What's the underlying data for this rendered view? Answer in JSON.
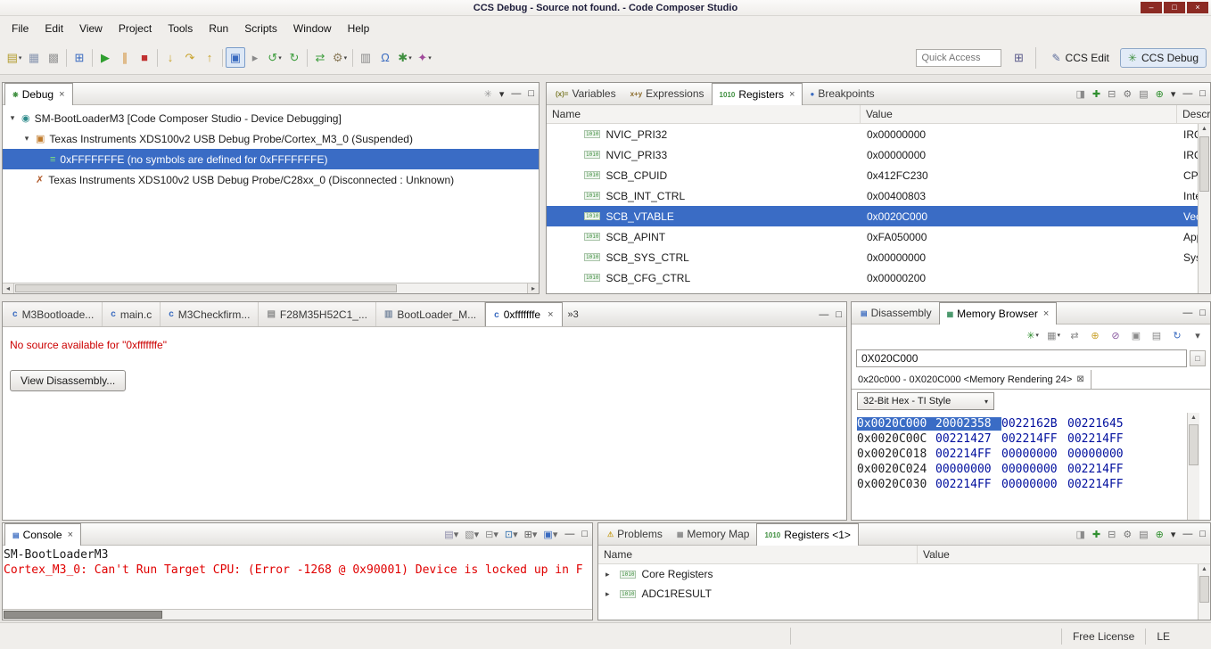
{
  "ui": {
    "dropdown_arrow": "▾",
    "close_glyph": "×",
    "close_box": "⊠",
    "menu_glyph": "▾",
    "min_glyph": "—",
    "max_glyph": "□",
    "expand_collapsed": "▸",
    "bin_icon": "1010",
    "scroll_left": "◂",
    "scroll_right": "▸",
    "scroll_up": "▲",
    "scroll_down": "▼"
  },
  "colors": {
    "selection": "#3a6cc5",
    "error_text": "#e00000",
    "memory_value": "#000f9e",
    "titlebar_button": "#8c2b24"
  },
  "titlebar": {
    "title": "CCS Debug - Source not found. - Code Composer Studio",
    "buttons": [
      {
        "name": "minimize-button",
        "glyph": "–"
      },
      {
        "name": "maximize-button",
        "glyph": "□"
      },
      {
        "name": "close-button",
        "glyph": "×"
      }
    ]
  },
  "menubar": {
    "items": [
      {
        "name": "menu-file",
        "label": "File"
      },
      {
        "name": "menu-edit",
        "label": "Edit"
      },
      {
        "name": "menu-view",
        "label": "View"
      },
      {
        "name": "menu-project",
        "label": "Project"
      },
      {
        "name": "menu-tools",
        "label": "Tools"
      },
      {
        "name": "menu-run",
        "label": "Run"
      },
      {
        "name": "menu-scripts",
        "label": "Scripts"
      },
      {
        "name": "menu-window",
        "label": "Window"
      },
      {
        "name": "menu-help",
        "label": "Help"
      }
    ]
  },
  "toolbar": {
    "icons": [
      {
        "name": "new-file-button",
        "glyph": "▤",
        "color": "#b09a2a",
        "dd": true
      },
      {
        "name": "save-button",
        "glyph": "▦",
        "color": "#8a97b0"
      },
      {
        "name": "save-all-button",
        "glyph": "▩",
        "color": "#9a9a9a"
      },
      {
        "name": "separator",
        "sep": true,
        "glyph": ""
      },
      {
        "name": "target-console-button",
        "glyph": "⊞",
        "color": "#3a6bc0"
      },
      {
        "name": "separator",
        "sep": true,
        "glyph": ""
      },
      {
        "name": "resume-button",
        "glyph": "▶",
        "color": "#2f9e2f"
      },
      {
        "name": "suspend-button",
        "glyph": "∥",
        "color": "#d08a2a"
      },
      {
        "name": "terminate-button",
        "glyph": "■",
        "color": "#c03030"
      },
      {
        "name": "separator",
        "sep": true,
        "glyph": ""
      },
      {
        "name": "step-into-button",
        "glyph": "↓",
        "color": "#c8a22a"
      },
      {
        "name": "step-over-button",
        "glyph": "↷",
        "color": "#c8a22a"
      },
      {
        "name": "step-return-button",
        "glyph": "↑",
        "color": "#c8a22a"
      },
      {
        "name": "separator",
        "sep": true,
        "glyph": ""
      },
      {
        "name": "instruction-stepping-toggle",
        "glyph": "▣",
        "color": "#3a6bc0",
        "pressed": true
      },
      {
        "name": "assembly-step-button",
        "glyph": "▸",
        "color": "#8a8a8a"
      },
      {
        "name": "reset-button",
        "glyph": "↺",
        "color": "#3f9e3f",
        "dd": true
      },
      {
        "name": "restart-button",
        "glyph": "↻",
        "color": "#3f9e3f"
      },
      {
        "name": "separator",
        "sep": true,
        "glyph": ""
      },
      {
        "name": "refresh-button",
        "glyph": "⇄",
        "color": "#3f9e3f"
      },
      {
        "name": "build-button",
        "glyph": "⚙",
        "color": "#8a7a5a",
        "dd": true
      },
      {
        "name": "separator",
        "sep": true,
        "glyph": ""
      },
      {
        "name": "new-target-configuration-button",
        "glyph": "▥",
        "color": "#8a8a8a"
      },
      {
        "name": "free-run-button",
        "glyph": "Ω",
        "color": "#3a6bc0"
      },
      {
        "name": "flash-button",
        "glyph": "✱",
        "color": "#3f8f3f",
        "dd": true
      },
      {
        "name": "profile-button",
        "glyph": "✦",
        "color": "#a04a9a",
        "dd": true
      }
    ],
    "quick_access_placeholder": "Quick Access",
    "open_perspective_icon": "⊞",
    "perspectives": [
      {
        "name": "perspective-ccs-edit",
        "label": "CCS Edit",
        "glyph": "✎",
        "glyph_color": "#5a6a9a"
      },
      {
        "name": "perspective-ccs-debug",
        "label": "CCS Debug",
        "glyph": "✳",
        "glyph_color": "#3f8f3f",
        "active": true
      }
    ]
  },
  "debug_view": {
    "tabs": [
      {
        "name": "tab-debug",
        "label": "Debug",
        "icon": "❋",
        "icon_color": "#3f8f3f",
        "active": true,
        "close": true
      }
    ],
    "toolbar": [
      {
        "name": "debug-view-action",
        "glyph": "✳",
        "color": "#9a9a9a"
      }
    ],
    "tree": [
      {
        "name": "launch-node",
        "label": "SM-BootLoaderM3 [Code Composer Studio - Device Debugging]",
        "level": 0,
        "expand": "▾",
        "icon": "◉",
        "icon_color": "#2e8b8b"
      },
      {
        "name": "core-cortex-m3-node",
        "label": "Texas Instruments XDS100v2 USB Debug Probe/Cortex_M3_0 (Suspended)",
        "level": 1,
        "expand": "▾",
        "icon": "▣",
        "icon_color": "#c07a2a"
      },
      {
        "name": "stack-frame-node",
        "label": "0xFFFFFFFE  (no symbols are defined for 0xFFFFFFFE)",
        "level": 2,
        "expand": "",
        "icon": "≡",
        "icon_color": "#7fe07f",
        "sel": true
      },
      {
        "name": "core-c28xx-node",
        "label": "Texas Instruments XDS100v2 USB Debug Probe/C28xx_0 (Disconnected : Unknown)",
        "level": 1,
        "expand": "",
        "icon": "✗",
        "icon_color": "#b05a2a"
      }
    ]
  },
  "registers_view": {
    "tabs": [
      {
        "name": "tab-variables",
        "label": "Variables",
        "icon": "(x)=",
        "icon_color": "#7a7a2a"
      },
      {
        "name": "tab-expressions",
        "label": "Expressions",
        "icon": "x+y",
        "icon_color": "#8a6a2a"
      },
      {
        "name": "tab-registers",
        "label": "Registers",
        "icon": "1010",
        "icon_color": "#3f8f3f",
        "active": true,
        "close": true
      },
      {
        "name": "tab-breakpoints",
        "label": "Breakpoints",
        "icon": "●",
        "icon_color": "#3a6bc0"
      }
    ],
    "toolbar": [
      {
        "name": "show-registers-action",
        "glyph": "◨",
        "color": "#8a8a8a"
      },
      {
        "name": "add-register-group-action",
        "glyph": "✚",
        "color": "#2f8f2f"
      },
      {
        "name": "collapse-all-action",
        "glyph": "⊟",
        "color": "#777777"
      },
      {
        "name": "settings-action",
        "glyph": "⚙",
        "color": "#777777"
      },
      {
        "name": "new-group-action",
        "glyph": "▤",
        "color": "#777777"
      },
      {
        "name": "link-action",
        "glyph": "⊕",
        "color": "#2f8f2f"
      }
    ],
    "columns": {
      "name": "Name",
      "value": "Value",
      "description": "Description"
    },
    "rows": [
      {
        "name": "NVIC_PRI32",
        "value": "0x00000000",
        "desc": "IRQ"
      },
      {
        "name": "NVIC_PRI33",
        "value": "0x00000000",
        "desc": "IRQ"
      },
      {
        "name": "SCB_CPUID",
        "value": "0x412FC230",
        "desc": "CPUI"
      },
      {
        "name": "SCB_INT_CTRL",
        "value": "0x00400803",
        "desc": "Inter"
      },
      {
        "name": "SCB_VTABLE",
        "value": "0x0020C000",
        "desc": "Vect",
        "sel": true
      },
      {
        "name": "SCB_APINT",
        "value": "0xFA050000",
        "desc": "App."
      },
      {
        "name": "SCB_SYS_CTRL",
        "value": "0x00000000",
        "desc": "Syst"
      },
      {
        "name": "SCB_CFG_CTRL",
        "value": "0x00000200",
        "desc": ""
      }
    ]
  },
  "editor": {
    "tabs": [
      {
        "name": "tab-m3bootloader",
        "label": "M3Bootloade...",
        "icon": "c",
        "icon_color": "#3a6bc0"
      },
      {
        "name": "tab-main-c",
        "label": "main.c",
        "icon": "c",
        "icon_color": "#3a6bc0"
      },
      {
        "name": "tab-m3checkfirm",
        "label": "M3Checkfirm...",
        "icon": "c",
        "icon_color": "#3a6bc0"
      },
      {
        "name": "tab-f28m35h52c1",
        "label": "F28M35H52C1_...",
        "icon": "▤",
        "icon_color": "#8a8a8a"
      },
      {
        "name": "tab-bootloader-map",
        "label": "BootLoader_M...",
        "icon": "▥",
        "icon_color": "#7a8aa0"
      },
      {
        "name": "tab-0xfffffffe",
        "label": "0xfffffffe",
        "icon": "c",
        "icon_color": "#3a6bc0",
        "active": true,
        "close": true
      }
    ],
    "overflow_label": "»3",
    "message": "No source available for \"0xfffffffe\"",
    "view_disassembly_label": "View Disassembly..."
  },
  "memory_view": {
    "tabs": [
      {
        "name": "tab-disassembly",
        "label": "Disassembly",
        "icon": "▤",
        "icon_color": "#3a6bc0"
      },
      {
        "name": "tab-memory-browser",
        "label": "Memory Browser",
        "icon": "▦",
        "icon_color": "#3a8f5f",
        "active": true,
        "close": true
      }
    ],
    "toolbar": [
      {
        "name": "refresh-memory-action",
        "glyph": "✳",
        "color": "#2f8f2f",
        "dd": true
      },
      {
        "name": "chart-action",
        "glyph": "▦",
        "color": "#8a8a8a",
        "dd": true
      },
      {
        "name": "navigate-action",
        "glyph": "⇄",
        "color": "#8a8a8a"
      },
      {
        "name": "new-tab-action",
        "glyph": "⊕",
        "color": "#caa22a"
      },
      {
        "name": "link-rendering-action",
        "glyph": "⊘",
        "color": "#8a5aa0"
      },
      {
        "name": "new-rendering-action",
        "glyph": "▣",
        "color": "#8a8a8a"
      },
      {
        "name": "pin-rendering-action",
        "glyph": "▤",
        "color": "#8a8a8a"
      },
      {
        "name": "reload-action",
        "glyph": "↻",
        "color": "#3a6bc0"
      },
      {
        "name": "memory-menu",
        "glyph": "▾",
        "color": "#555555"
      }
    ],
    "address_value": "0X020C000",
    "rendering_tab_label": "0x20c000 - 0X020C000 <Memory Rendering 24>",
    "format_value": "32-Bit Hex - TI Style",
    "rows": [
      {
        "addr": "0x0020C000",
        "v0": "20002358",
        "v1": "0022162B",
        "v2": "00221645",
        "sel": true
      },
      {
        "addr": "0x0020C00C",
        "v0": "00221427",
        "v1": "002214FF",
        "v2": "002214FF"
      },
      {
        "addr": "0x0020C018",
        "v0": "002214FF",
        "v1": "00000000",
        "v2": "00000000"
      },
      {
        "addr": "0x0020C024",
        "v0": "00000000",
        "v1": "00000000",
        "v2": "002214FF"
      },
      {
        "addr": "0x0020C030",
        "v0": "002214FF",
        "v1": "00000000",
        "v2": "002214FF"
      }
    ]
  },
  "console_view": {
    "tabs": [
      {
        "name": "tab-console",
        "label": "Console",
        "icon": "▤",
        "icon_color": "#3a6bc0",
        "active": true,
        "close": true
      }
    ],
    "toolbar": [
      {
        "name": "name-console-action",
        "glyph": "▤",
        "color": "#8a8aa8"
      },
      {
        "name": "clear-console-action",
        "glyph": "▧",
        "color": "#8a8a8a"
      },
      {
        "name": "scroll-lock-action",
        "glyph": "⊟",
        "color": "#8a8a8a"
      },
      {
        "name": "pin-console-action",
        "glyph": "⊡",
        "color": "#2f6fae"
      },
      {
        "name": "display-selected-console-action",
        "glyph": "⊞",
        "color": "#5a5a5a",
        "dd": true
      },
      {
        "name": "open-console-action",
        "glyph": "▣",
        "color": "#3a6bc0",
        "dd": true
      }
    ],
    "lines": [
      {
        "text": "SM-BootLoaderM3"
      },
      {
        "text": "Cortex_M3_0: Can't Run Target CPU: (Error -1268 @ 0x90001) Device is locked up in F",
        "error": true
      }
    ]
  },
  "problems_view": {
    "tabs": [
      {
        "name": "tab-problems",
        "label": "Problems",
        "icon": "⚠",
        "icon_color": "#c8a22a"
      },
      {
        "name": "tab-memory-map",
        "label": "Memory Map",
        "icon": "▦",
        "icon_color": "#8a8a8a"
      },
      {
        "name": "tab-registers-1",
        "label": "Registers <1>",
        "icon": "1010",
        "icon_color": "#3f8f3f",
        "active": true
      }
    ],
    "toolbar": [
      {
        "name": "show-registers-action",
        "glyph": "◨",
        "color": "#8a8a8a"
      },
      {
        "name": "add-register-group-action",
        "glyph": "✚",
        "color": "#2f8f2f"
      },
      {
        "name": "collapse-all-action",
        "glyph": "⊟",
        "color": "#777777"
      },
      {
        "name": "settings-action",
        "glyph": "⚙",
        "color": "#777777"
      },
      {
        "name": "new-group-action",
        "glyph": "▤",
        "color": "#777777"
      },
      {
        "name": "link-action",
        "glyph": "⊕",
        "color": "#2f8f2f"
      }
    ],
    "columns": {
      "name": "Name",
      "value": "Value"
    },
    "rows": [
      {
        "name": "row-core-registers",
        "label": "Core Registers"
      },
      {
        "name": "row-adc1result",
        "label": "ADC1RESULT"
      }
    ]
  },
  "statusbar": {
    "items": [
      "Free License",
      "LE"
    ]
  }
}
